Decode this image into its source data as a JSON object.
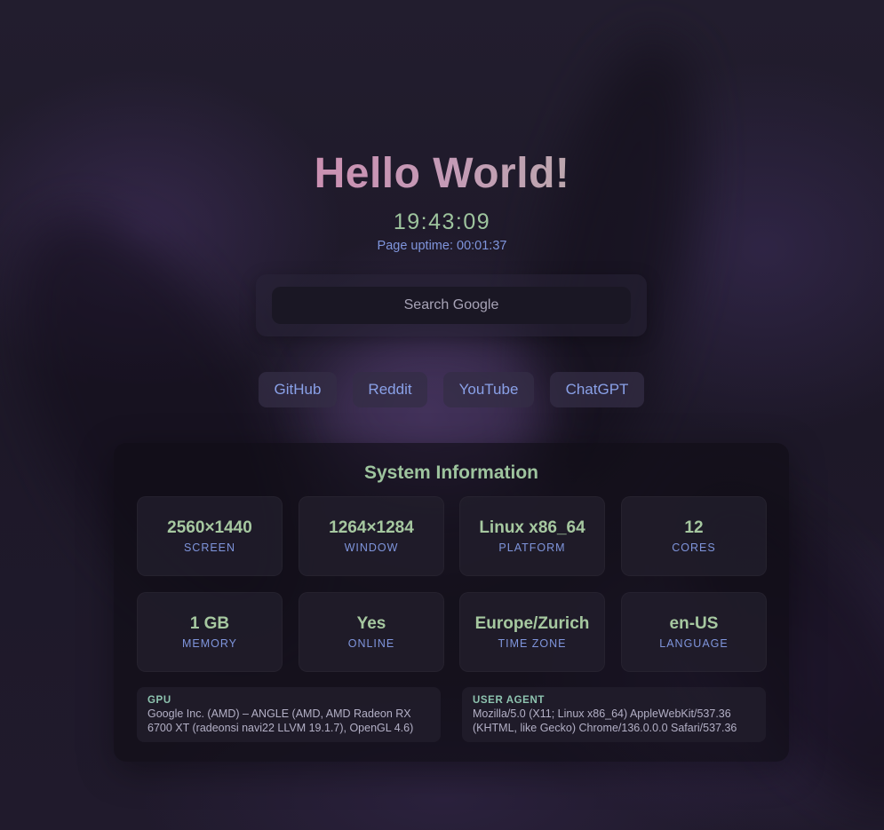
{
  "hero": {
    "title": "Hello World!",
    "clock": "19:43:09",
    "uptime_label": "Page uptime:",
    "uptime_value": "00:01:37"
  },
  "search": {
    "placeholder": "Search Google",
    "icon": "search-icon"
  },
  "quick_links": [
    {
      "label": "GitHub"
    },
    {
      "label": "Reddit"
    },
    {
      "label": "YouTube"
    },
    {
      "label": "ChatGPT"
    }
  ],
  "system_info": {
    "title": "System Information",
    "cards": [
      {
        "value": "2560×1440",
        "label": "SCREEN"
      },
      {
        "value": "1264×1284",
        "label": "WINDOW"
      },
      {
        "value": "Linux x86_64",
        "label": "PLATFORM"
      },
      {
        "value": "12",
        "label": "CORES"
      },
      {
        "value": "1 GB",
        "label": "MEMORY"
      },
      {
        "value": "Yes",
        "label": "ONLINE"
      },
      {
        "value": "Europe/Zurich",
        "label": "TIME ZONE"
      },
      {
        "value": "en-US",
        "label": "LANGUAGE"
      }
    ],
    "gpu": {
      "heading": "GPU",
      "line1": "Google Inc. (AMD) – ANGLE (AMD, AMD Radeon RX",
      "line2": "6700 XT (radeonsi navi22 LLVM 19.1.7), OpenGL 4.6)"
    },
    "user_agent": {
      "heading": "USER AGENT",
      "line1": "Mozilla/5.0 (X11; Linux x86_64) AppleWebKit/537.36",
      "line2": "(KHTML, like Gecko) Chrome/136.0.0.0 Safari/537.36"
    }
  },
  "colors": {
    "background": "#1c1826",
    "title_gradient_start": "#dc7aa8",
    "title_gradient_end": "#a9c49a",
    "accent_green": "#9ec49e",
    "accent_blue": "#7f95dc",
    "link_text": "#8aa1e8"
  }
}
